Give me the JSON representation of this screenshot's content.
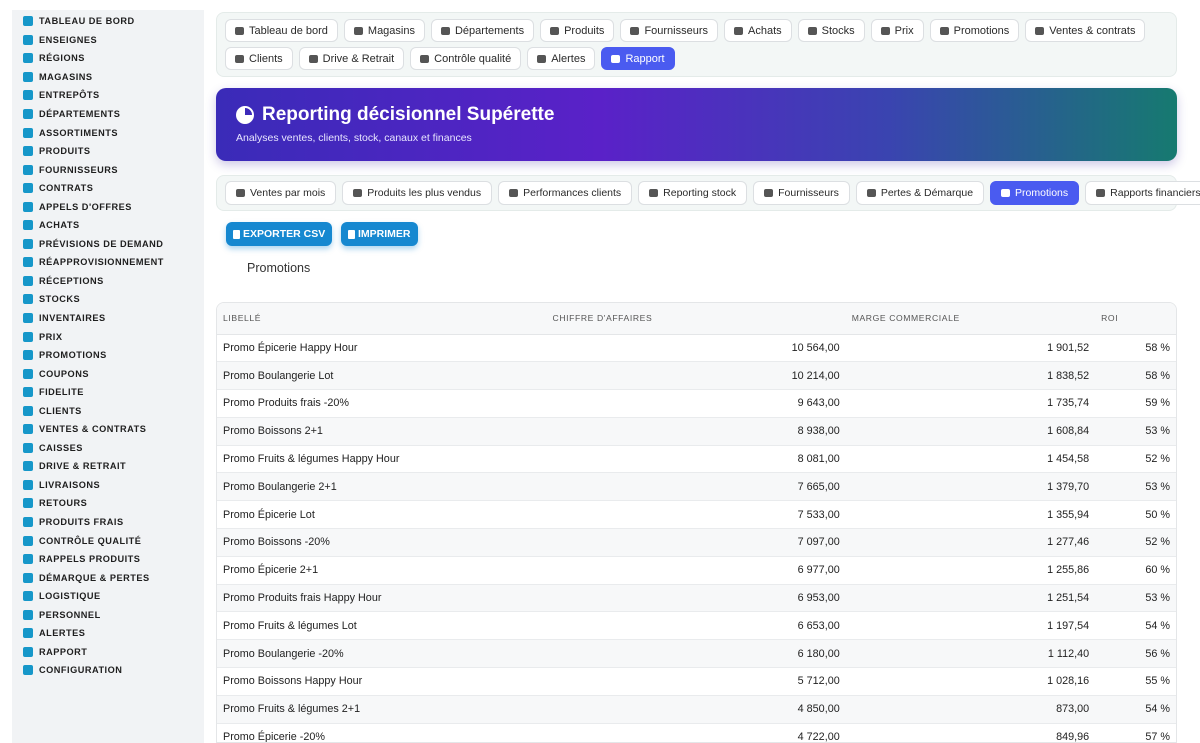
{
  "sidebar": {
    "items": [
      {
        "label": "Tableau de bord",
        "icon": "dashboard-icon"
      },
      {
        "label": "Enseignes",
        "icon": "flag-icon"
      },
      {
        "label": "Régions",
        "icon": "map-icon"
      },
      {
        "label": "Magasins",
        "icon": "store-icon"
      },
      {
        "label": "Entrepôts",
        "icon": "warehouse-icon"
      },
      {
        "label": "Départements",
        "icon": "basket-icon"
      },
      {
        "label": "Assortiments",
        "icon": "list-icon"
      },
      {
        "label": "Produits",
        "icon": "box-icon"
      },
      {
        "label": "Fournisseurs",
        "icon": "truck-icon"
      },
      {
        "label": "Contrats",
        "icon": "file-icon"
      },
      {
        "label": "Appels d'offres",
        "icon": "gavel-icon"
      },
      {
        "label": "Achats",
        "icon": "cart-icon"
      },
      {
        "label": "Prévisions de demand",
        "icon": "chart-icon"
      },
      {
        "label": "Réapprovisionnement",
        "icon": "refresh-icon"
      },
      {
        "label": "Réceptions",
        "icon": "inbox-icon"
      },
      {
        "label": "Stocks",
        "icon": "cubes-icon"
      },
      {
        "label": "Inventaires",
        "icon": "clipboard-icon"
      },
      {
        "label": "Prix",
        "icon": "tag-icon"
      },
      {
        "label": "Promotions",
        "icon": "percent-icon"
      },
      {
        "label": "Coupons",
        "icon": "ticket-icon"
      },
      {
        "label": "Fidelite",
        "icon": "card-icon"
      },
      {
        "label": "Clients",
        "icon": "user-icon"
      },
      {
        "label": "Ventes & contrats",
        "icon": "receipt-icon"
      },
      {
        "label": "Caisses",
        "icon": "cash-register-icon"
      },
      {
        "label": "Drive & retrait",
        "icon": "car-icon"
      },
      {
        "label": "Livraisons",
        "icon": "delivery-icon"
      },
      {
        "label": "Retours",
        "icon": "undo-icon"
      },
      {
        "label": "Produits frais",
        "icon": "leaf-icon"
      },
      {
        "label": "Contrôle qualité",
        "icon": "check-icon"
      },
      {
        "label": "Rappels produits",
        "icon": "warning-icon"
      },
      {
        "label": "Démarque & pertes",
        "icon": "trash-icon"
      },
      {
        "label": "Logistique",
        "icon": "route-icon"
      },
      {
        "label": "Personnel",
        "icon": "users-icon"
      },
      {
        "label": "Alertes",
        "icon": "bell-icon"
      },
      {
        "label": "Rapport",
        "icon": "pie-chart-icon"
      },
      {
        "label": "Configuration",
        "icon": "gear-icon"
      }
    ]
  },
  "topnav": {
    "items": [
      {
        "label": "Tableau de bord",
        "active": false
      },
      {
        "label": "Magasins",
        "active": false
      },
      {
        "label": "Départements",
        "active": false
      },
      {
        "label": "Produits",
        "active": false
      },
      {
        "label": "Fournisseurs",
        "active": false
      },
      {
        "label": "Achats",
        "active": false
      },
      {
        "label": "Stocks",
        "active": false
      },
      {
        "label": "Prix",
        "active": false
      },
      {
        "label": "Promotions",
        "active": false
      },
      {
        "label": "Ventes & contrats",
        "active": false
      },
      {
        "label": "Clients",
        "active": false
      },
      {
        "label": "Drive & Retrait",
        "active": false
      },
      {
        "label": "Contrôle qualité",
        "active": false
      },
      {
        "label": "Alertes",
        "active": false
      },
      {
        "label": "Rapport",
        "active": true
      }
    ]
  },
  "banner": {
    "title": "Reporting décisionnel Supérette",
    "subtitle": "Analyses ventes, clients, stock, canaux et finances"
  },
  "subnav": {
    "items": [
      {
        "label": "Ventes par mois",
        "active": false
      },
      {
        "label": "Produits les plus vendus",
        "active": false
      },
      {
        "label": "Performances clients",
        "active": false
      },
      {
        "label": "Reporting stock",
        "active": false
      },
      {
        "label": "Fournisseurs",
        "active": false
      },
      {
        "label": "Pertes & Démarque",
        "active": false
      },
      {
        "label": "Promotions",
        "active": true
      },
      {
        "label": "Rapports financiers",
        "active": false
      }
    ]
  },
  "actions": {
    "export_label": "EXPORTER CSV",
    "print_label": "IMPRIMER"
  },
  "section_title": "Promotions",
  "table": {
    "headers": [
      "Libellé",
      "Chiffre d'affaires",
      "Marge commerciale",
      "ROI"
    ],
    "rows": [
      [
        "Promo Épicerie Happy Hour",
        "10 564,00",
        "1 901,52",
        "58 %"
      ],
      [
        "Promo Boulangerie Lot",
        "10 214,00",
        "1 838,52",
        "58 %"
      ],
      [
        "Promo Produits frais -20%",
        "9 643,00",
        "1 735,74",
        "59 %"
      ],
      [
        "Promo Boissons 2+1",
        "8 938,00",
        "1 608,84",
        "53 %"
      ],
      [
        "Promo Fruits & légumes Happy Hour",
        "8 081,00",
        "1 454,58",
        "52 %"
      ],
      [
        "Promo Boulangerie 2+1",
        "7 665,00",
        "1 379,70",
        "53 %"
      ],
      [
        "Promo Épicerie Lot",
        "7 533,00",
        "1 355,94",
        "50 %"
      ],
      [
        "Promo Boissons -20%",
        "7 097,00",
        "1 277,46",
        "52 %"
      ],
      [
        "Promo Épicerie 2+1",
        "6 977,00",
        "1 255,86",
        "60 %"
      ],
      [
        "Promo Produits frais Happy Hour",
        "6 953,00",
        "1 251,54",
        "53 %"
      ],
      [
        "Promo Fruits & légumes Lot",
        "6 653,00",
        "1 197,54",
        "54 %"
      ],
      [
        "Promo Boulangerie -20%",
        "6 180,00",
        "1 112,40",
        "56 %"
      ],
      [
        "Promo Boissons Happy Hour",
        "5 712,00",
        "1 028,16",
        "55 %"
      ],
      [
        "Promo Fruits & légumes 2+1",
        "4 850,00",
        "873,00",
        "54 %"
      ],
      [
        "Promo Épicerie -20%",
        "4 722,00",
        "849,96",
        "57 %"
      ]
    ]
  },
  "colors": {
    "accent": "#4a5bf0",
    "sidebar_icon": "#1697c9",
    "button": "#1688d0"
  }
}
